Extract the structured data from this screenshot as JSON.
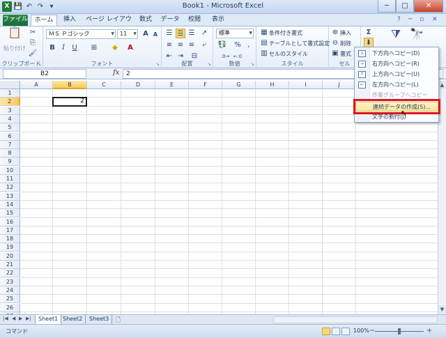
{
  "window": {
    "title": "Book1 - Microsoft Excel",
    "min": "─",
    "max": "□",
    "close": "✕"
  },
  "qat": {
    "app": "X",
    "save": "💾",
    "undo": "↶",
    "redo": "↷",
    "more": "▾"
  },
  "tabs": [
    "ファイル",
    "ホーム",
    "挿入",
    "ページ レイアウト",
    "数式",
    "データ",
    "校閲",
    "表示"
  ],
  "tabs_right": {
    "help": "?",
    "min": "─",
    "restore": "▫",
    "close": "✕"
  },
  "ribbon": {
    "clipboard": {
      "label": "クリップボード",
      "paste": "貼り付け"
    },
    "font": {
      "label": "フォント",
      "name": "ＭＳ Ｐゴシック",
      "size": "11",
      "bold": "B",
      "italic": "I",
      "underline": "U",
      "grow": "A",
      "shrink": "A"
    },
    "alignment": {
      "label": "配置"
    },
    "number": {
      "label": "数値",
      "format": "標準",
      "percent": "%",
      "comma": ","
    },
    "styles": {
      "label": "スタイル",
      "conditional": "条件付き書式",
      "table": "テーブルとして書式設定",
      "cell": "セルのスタイル"
    },
    "cells": {
      "label": "セル",
      "insert": "挿入",
      "delete": "削除",
      "format": "書式"
    },
    "editing": {
      "sigma": "Σ"
    }
  },
  "formula_bar": {
    "name_box": "B2",
    "fx": "fx",
    "value": "2"
  },
  "grid": {
    "columns": [
      "A",
      "B",
      "C",
      "D",
      "E",
      "F",
      "G",
      "H",
      "I",
      "J"
    ],
    "selected_column": "B",
    "rows": [
      "1",
      "2",
      "3",
      "4",
      "5",
      "6",
      "7",
      "8",
      "9",
      "10",
      "11",
      "12",
      "13",
      "14",
      "15",
      "16",
      "17",
      "18",
      "19",
      "20",
      "21",
      "22",
      "23",
      "24",
      "25",
      "26",
      "27"
    ],
    "selected_row": "2",
    "active_cell_value": "2"
  },
  "fill_menu": {
    "items": [
      {
        "label": "下方向へコピー(D)",
        "icon": "↓",
        "disabled": false
      },
      {
        "label": "右方向へコピー(R)",
        "icon": "→",
        "disabled": false
      },
      {
        "label": "上方向へコピー(U)",
        "icon": "↑",
        "disabled": false
      },
      {
        "label": "左方向へコピー(L)",
        "icon": "←",
        "disabled": false
      },
      {
        "label": "作業グループへコピー(A)...",
        "icon": "",
        "disabled": true
      },
      {
        "label": "連続データの作成(S)...",
        "icon": "",
        "disabled": false
      },
      {
        "label": "文字の割付(J)",
        "icon": "",
        "disabled": false
      }
    ],
    "highlighted": "連続データの作成(S)..."
  },
  "sheets": [
    "Sheet1",
    "Sheet2",
    "Sheet3"
  ],
  "active_sheet": "Sheet1",
  "status": {
    "mode": "コマンド",
    "zoom": "100%",
    "zoom_fraction": 0.5
  },
  "colors": {
    "accent": "#1f7a38",
    "highlight": "#e0141e",
    "selection": "#f8c95b"
  }
}
